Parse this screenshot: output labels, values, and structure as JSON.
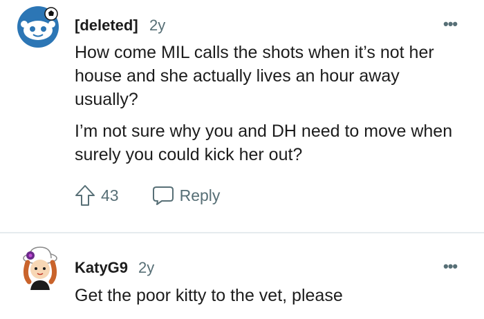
{
  "comments": [
    {
      "username": "[deleted]",
      "age": "2y",
      "more_icon": "more-horizontal-icon",
      "avatar_icon": "snoo-avatar-icon",
      "paragraphs": [
        "How come MIL calls the shots when it’s not her house and she actually lives an hour away usually?",
        "I’m not sure why you and DH need to move when surely you could kick her out?"
      ],
      "upvotes": "43",
      "reply_label": "Reply"
    },
    {
      "username": "KatyG9",
      "age": "2y",
      "more_icon": "more-horizontal-icon",
      "avatar_icon": "user-avatar-icon",
      "paragraphs": [
        "Get the poor kitty to the vet, please"
      ]
    }
  ],
  "colors": {
    "text": "#1c1c1c",
    "meta": "#576f76",
    "divider": "#e5ebee",
    "snoo_bg": "#2c76b5"
  }
}
